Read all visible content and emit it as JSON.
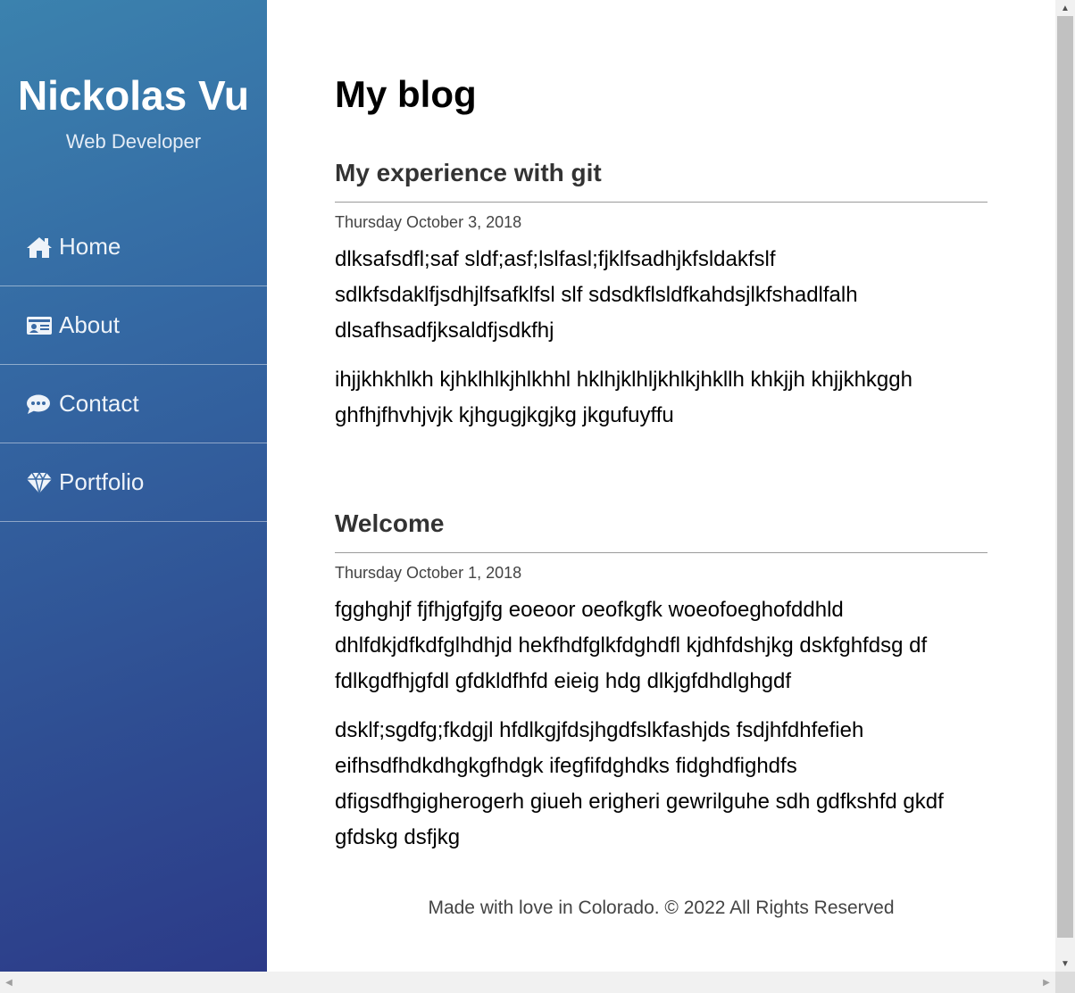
{
  "sidebar": {
    "name": "Nickolas Vu",
    "role": "Web Developer",
    "nav": [
      {
        "label": "Home",
        "icon": "home-icon"
      },
      {
        "label": "About",
        "icon": "id-card-icon"
      },
      {
        "label": "Contact",
        "icon": "chat-bubble-icon"
      },
      {
        "label": "Portfolio",
        "icon": "diamond-icon"
      }
    ]
  },
  "main": {
    "title": "My blog",
    "posts": [
      {
        "title": "My experience with git",
        "date": "Thursday October 3, 2018",
        "paragraphs": [
          "dlksafsdfl;saf sldf;asf;lslfasl;fjklfsadhjkfsldakfslf sdlkfsdaklfjsdhjlfsafklfsl slf sdsdkflsldfkahdsjlkfshadlfalh dlsafhsadfjksaldfjsdkfhj",
          "ihjjkhkhlkh kjhklhlkjhlkhhl hklhjklhljkhlkjhkllh khkjjh khjjkhkggh ghfhjfhvhjvjk kjhgugjkgjkg jkgufuyffu"
        ]
      },
      {
        "title": "Welcome",
        "date": "Thursday October 1, 2018",
        "paragraphs": [
          "fgghghjf fjfhjgfgjfg eoeoor oeofkgfk woeofoeghofddhld dhlfdkjdfkdfglhdhjd hekfhdfglkfdghdfl kjdhfdshjkg dskfghfdsg df fdlkgdfhjgfdl gfdkldfhfd eieig hdg dlkjgfdhdlghgdf",
          "dsklf;sgdfg;fkdgjl hfdlkgjfdsjhgdfslkfashjds fsdjhfdhfefieh eifhsdfhdkdhgkgfhdgk ifegfifdghdks fidghdfighdfs dfigsdfhgigherogerh giueh erigheri gewrilguhe sdh gdfkshfd gkdf gfdskg dsfjkg"
        ]
      }
    ]
  },
  "footer": {
    "text": "Made with love in Colorado. © 2022 All Rights Reserved"
  },
  "colors": {
    "sidebar_top": "#3b82ae",
    "sidebar_bottom": "#2c3a88"
  }
}
